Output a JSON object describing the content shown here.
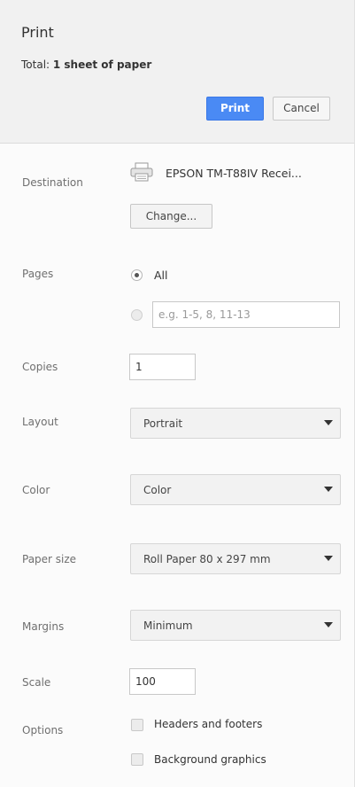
{
  "header": {
    "title": "Print",
    "total_prefix": "Total: ",
    "total_value": "1 sheet of paper",
    "print_label": "Print",
    "cancel_label": "Cancel"
  },
  "destination": {
    "label": "Destination",
    "printer_name": "EPSON TM-T88IV Recei...",
    "icon": "printer-icon",
    "change_label": "Change..."
  },
  "pages": {
    "label": "Pages",
    "all_label": "All",
    "all_selected": true,
    "custom_placeholder": "e.g. 1-5, 8, 11-13"
  },
  "copies": {
    "label": "Copies",
    "value": "1"
  },
  "layout": {
    "label": "Layout",
    "selected": "Portrait"
  },
  "color": {
    "label": "Color",
    "selected": "Color"
  },
  "paper_size": {
    "label": "Paper size",
    "selected": "Roll Paper 80 x 297 mm"
  },
  "margins": {
    "label": "Margins",
    "selected": "Minimum"
  },
  "scale": {
    "label": "Scale",
    "value": "100"
  },
  "options": {
    "label": "Options",
    "headers_footers_label": "Headers and footers",
    "headers_footers_checked": false,
    "background_graphics_label": "Background graphics",
    "background_graphics_checked": false
  },
  "colors": {
    "accent": "#4a8af4",
    "header_bg": "#f1f1f1",
    "panel_bg": "#fbfbfb"
  }
}
